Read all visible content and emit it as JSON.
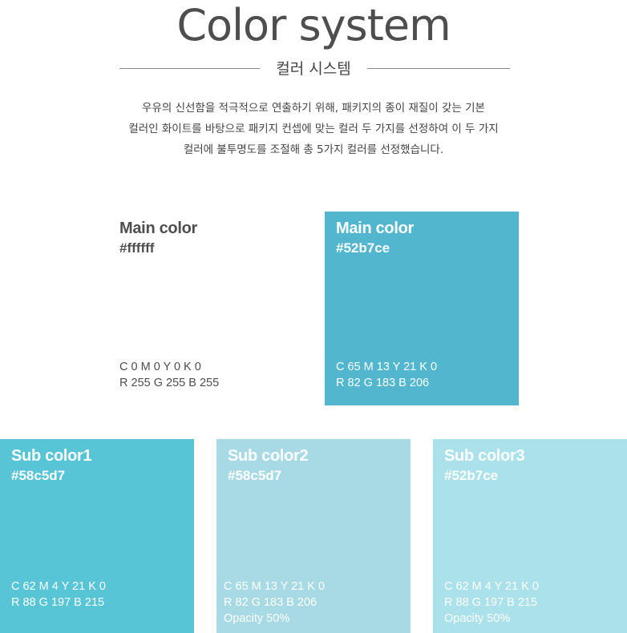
{
  "header": {
    "title": "Color system",
    "subtitle": "컬러 시스템",
    "description": [
      "우유의 신선함을 적극적으로 연출하기 위해, 패키지의 종이 재질이 갖는 기본",
      "컬러인 화이트를 바탕으로 패키지 컨셉에 맞는 컬러 두 가지를 선정하여 이 두 가지",
      "컬러에 불투명도를 조절해 총 5가지 컬러를 선정했습니다."
    ]
  },
  "main_colors": [
    {
      "name": "Main color",
      "hex": "#ffffff",
      "cmyk": "C 0 M 0 Y 0 K 0",
      "rgb": "R 255 G 255 B 255",
      "swatch": "#ffffff"
    },
    {
      "name": "Main color",
      "hex": "#52b7ce",
      "cmyk": "C 65 M 13 Y 21 K 0",
      "rgb": "R 82 G 183 B 206",
      "swatch": "#52b7ce"
    }
  ],
  "sub_colors": [
    {
      "name": "Sub color1",
      "hex": "#58c5d7",
      "cmyk": "C 62 M 4 Y 21 K 0",
      "rgb": "R 88 G 197 B 215",
      "opacity": "",
      "swatch": "#58c5d7"
    },
    {
      "name": "Sub color2",
      "hex": "#58c5d7",
      "cmyk": "C 65 M 13 Y 21 K 0",
      "rgb": "R 82 G 183 B 206",
      "opacity": "Opacity 50%",
      "swatch": "#a8dae6"
    },
    {
      "name": "Sub color3",
      "hex": "#52b7ce",
      "cmyk": "C 62 M 4 Y 21 K 0",
      "rgb": "R 88 G 197 B 215",
      "opacity": "Opacity 50%",
      "swatch": "#abe1ea"
    }
  ]
}
